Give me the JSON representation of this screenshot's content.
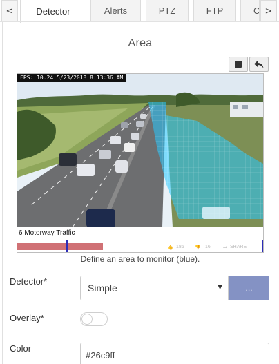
{
  "tabs": {
    "prev_arrow": "<",
    "next_arrow": ">",
    "items": [
      "Detector",
      "Alerts",
      "PTZ",
      "FTP",
      "Cl"
    ],
    "active": "Detector"
  },
  "area": {
    "title": "Area",
    "stop_icon": "stop-icon",
    "undo_icon": "undo-icon",
    "overlay_color": "#26c9ff"
  },
  "video": {
    "osd_text": "FPS: 10.24  5/23/2018 8:13:36 AM",
    "title": "6 Motorway Traffic",
    "likes": "186",
    "dislikes": "16",
    "share_label": "SHARE",
    "progress_played": 0.35
  },
  "caption": "Define an area to monitor (blue).",
  "form": {
    "detector_label": "Detector*",
    "detector_value": "Simple",
    "detector_options_button": "...",
    "overlay_label": "Overlay*",
    "overlay_on": false,
    "color_label": "Color",
    "color_value": "#26c9ff"
  },
  "colors": {
    "accent_button": "#8492c4",
    "progress": "#d07175",
    "marker": "#2d2db8"
  }
}
